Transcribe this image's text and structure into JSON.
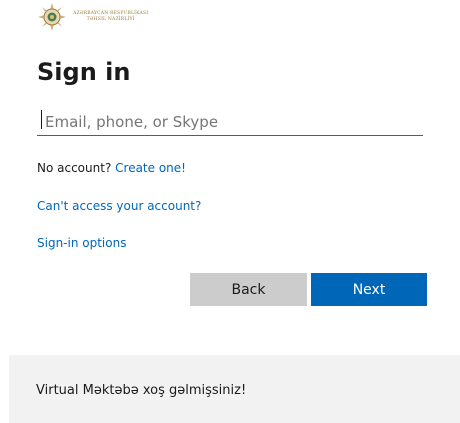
{
  "logo": {
    "line1": "AZƏRBAYCAN RESPUBLİKASI",
    "line2": "TƏHSİL NAZİRLİYİ"
  },
  "title": "Sign in",
  "email": {
    "value": "",
    "placeholder": "Email, phone, or Skype"
  },
  "no_account": {
    "text": "No account?",
    "link": "Create one!"
  },
  "cant_access": "Can't access your account?",
  "signin_options": "Sign-in options",
  "buttons": {
    "back": "Back",
    "next": "Next"
  },
  "footer": {
    "text": "Virtual Məktəbə xoş gəlmişsiniz!"
  },
  "colors": {
    "accent": "#0067b8",
    "back_button": "#cccccc",
    "footer_bg": "#f2f2f2"
  }
}
